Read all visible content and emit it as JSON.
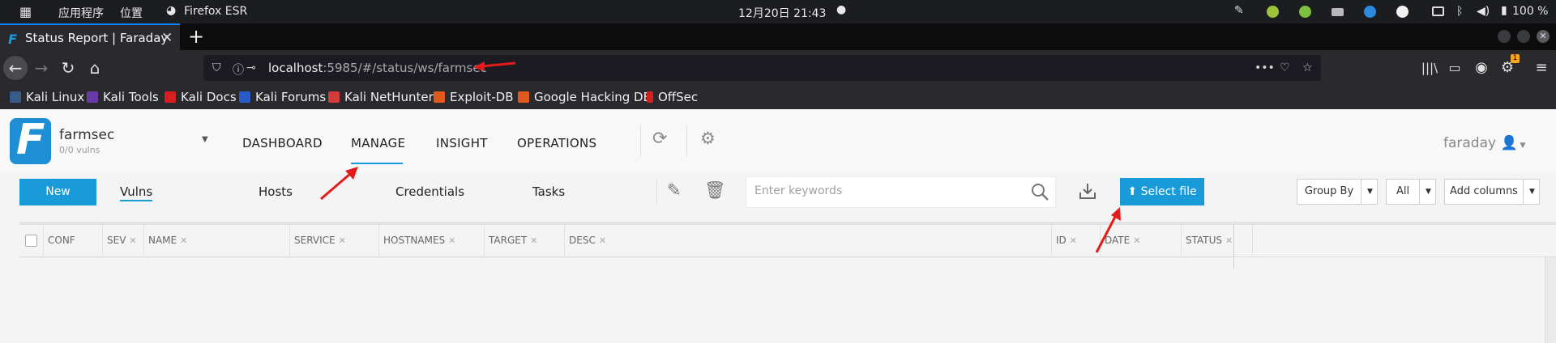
{
  "system_bar": {
    "apps_label": "应用程序",
    "places_label": "位置",
    "browser_label": "Firefox ESR",
    "datetime": "12月20日 21:43",
    "battery": "100 %",
    "update_badge": "1"
  },
  "tab": {
    "title": "Status Report | Faraday"
  },
  "urlbar": {
    "host": "localhost",
    "rest": ":5985/#/status/ws/farmsec"
  },
  "bookmarks": [
    {
      "label": "Kali Linux",
      "color": "#3a5a8a"
    },
    {
      "label": "Kali Tools",
      "color": "#6a3aa8"
    },
    {
      "label": "Kali Docs",
      "color": "#d42020"
    },
    {
      "label": "Kali Forums",
      "color": "#2a5ac8"
    },
    {
      "label": "Kali NetHunter",
      "color": "#d43a3a"
    },
    {
      "label": "Exploit-DB",
      "color": "#e05a20"
    },
    {
      "label": "Google Hacking DB",
      "color": "#e05a20"
    },
    {
      "label": "OffSec",
      "color": "#d42020"
    }
  ],
  "app": {
    "workspace_name": "farmsec",
    "workspace_vulns": "0/0 vulns",
    "nav": [
      "DASHBOARD",
      "MANAGE",
      "INSIGHT",
      "OPERATIONS"
    ],
    "user": "faraday",
    "accent": "#1a9bd9"
  },
  "toolbar": {
    "new_label": "New",
    "subtabs": [
      "Vulns",
      "Hosts",
      "Credentials",
      "Tasks"
    ],
    "search_placeholder": "Enter keywords",
    "select_file_label": "Select file",
    "group_by_label": "Group By",
    "all_label": "All",
    "add_columns_label": "Add columns"
  },
  "grid": {
    "columns": [
      "CONF",
      "SEV",
      "NAME",
      "SERVICE",
      "HOSTNAMES",
      "TARGET",
      "DESC",
      "ID",
      "DATE",
      "STATUS"
    ]
  }
}
